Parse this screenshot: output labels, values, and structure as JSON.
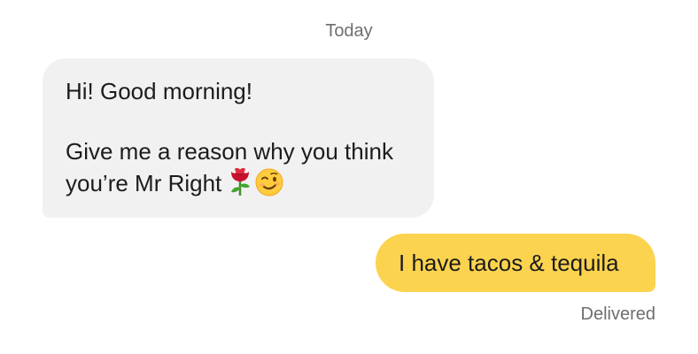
{
  "chat": {
    "date_label": "Today",
    "incoming": {
      "line1": "Hi! Good morning!",
      "line2": "Give me a reason why you think",
      "line3": "you’re Mr Right",
      "emojis": [
        "rose-icon",
        "winking-face-icon"
      ]
    },
    "outgoing": {
      "text": "I have tacos & tequila",
      "status": "Delivered"
    }
  },
  "colors": {
    "incoming_bubble": "#f1f1f1",
    "outgoing_bubble": "#fcd34f",
    "meta_text": "#6e6e6e"
  }
}
